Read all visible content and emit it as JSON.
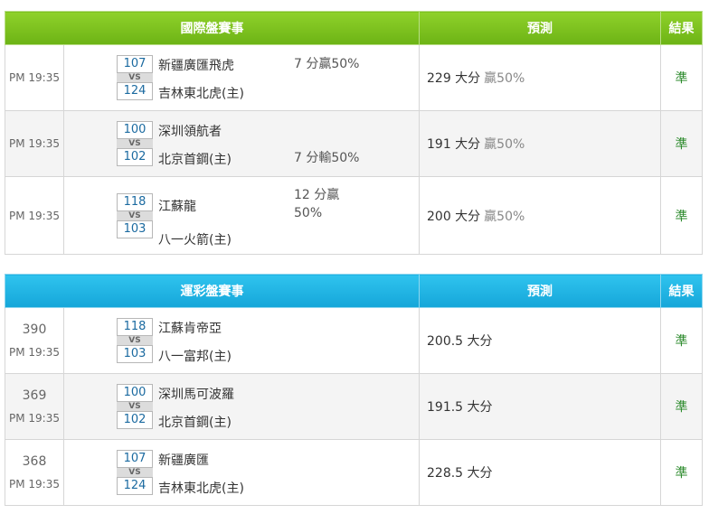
{
  "international": {
    "header": {
      "title": "國際盤賽事",
      "prediction": "預測",
      "result": "結果"
    },
    "rows": [
      {
        "time": "PM 19:35",
        "away_score": "107",
        "vs": "VS",
        "home_score": "124",
        "away_team": "新疆廣匯飛虎",
        "home_team": "吉林東北虎(主)",
        "handicap_line1": "7 分贏50%",
        "handicap_line2": "",
        "prediction": "229 大分",
        "prediction_pct": "贏50%",
        "result": "準"
      },
      {
        "time": "PM 19:35",
        "away_score": "100",
        "vs": "VS",
        "home_score": "102",
        "away_team": "深圳領航者",
        "home_team": "北京首鋼(主)",
        "handicap_line1": "7 分輸50%",
        "handicap_line2": "",
        "prediction": "191 大分",
        "prediction_pct": "贏50%",
        "result": "準"
      },
      {
        "time": "PM 19:35",
        "away_score": "118",
        "vs": "VS",
        "home_score": "103",
        "away_team": "江蘇龍",
        "home_team": "八一火箭(主)",
        "handicap_line1": "12 分贏",
        "handicap_line2": "50%",
        "prediction": "200 大分",
        "prediction_pct": "贏50%",
        "result": "準"
      }
    ]
  },
  "sports_lottery": {
    "header": {
      "title": "運彩盤賽事",
      "prediction": "預測",
      "result": "結果"
    },
    "rows": [
      {
        "code": "390",
        "time": "PM 19:35",
        "away_score": "118",
        "vs": "VS",
        "home_score": "103",
        "away_team": "江蘇肯帝亞",
        "home_team": "八一富邦(主)",
        "prediction": "200.5 大分",
        "result": "準"
      },
      {
        "code": "369",
        "time": "PM 19:35",
        "away_score": "100",
        "vs": "VS",
        "home_score": "102",
        "away_team": "深圳馬可波羅",
        "home_team": "北京首鋼(主)",
        "prediction": "191.5 大分",
        "result": "準"
      },
      {
        "code": "368",
        "time": "PM 19:35",
        "away_score": "107",
        "vs": "VS",
        "home_score": "124",
        "away_team": "新疆廣匯",
        "home_team": "吉林東北虎(主)",
        "prediction": "228.5 大分",
        "result": "準"
      }
    ]
  }
}
